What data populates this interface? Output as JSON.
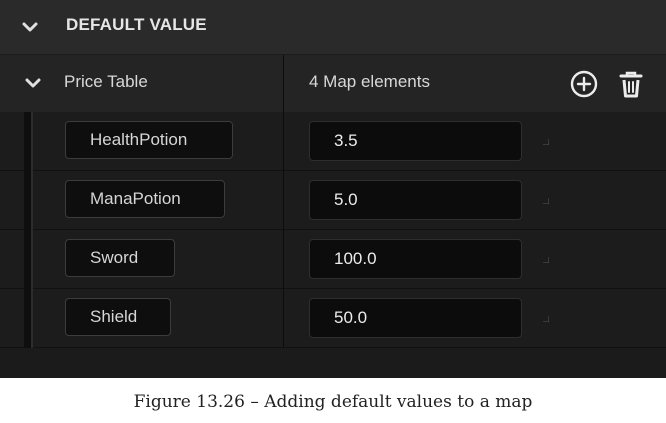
{
  "category": {
    "title": "DEFAULT VALUE",
    "expanded_icon": "chevron-down-icon"
  },
  "map_property": {
    "label": "Price Table",
    "summary": "4 Map elements",
    "add_icon": "plus-circle-icon",
    "delete_icon": "trash-icon"
  },
  "elements": [
    {
      "key": "HealthPotion",
      "value": "3.5"
    },
    {
      "key": "ManaPotion",
      "value": "5.0"
    },
    {
      "key": "Sword",
      "value": "100.0"
    },
    {
      "key": "Shield",
      "value": "50.0"
    }
  ],
  "caption": "Figure 13.26 – Adding default values to a map",
  "colors": {
    "panel_bg": "#151515",
    "header_bg": "#2a2a2a",
    "text": "#d8d8d8"
  }
}
